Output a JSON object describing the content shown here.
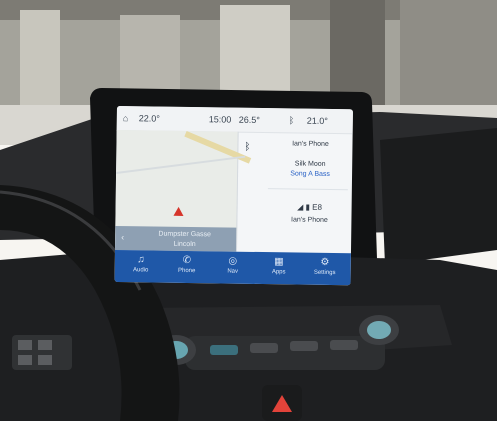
{
  "status_bar": {
    "temp_left": "22.0°",
    "clock": "15:00",
    "outside_temp": "26.5°",
    "temp_right": "21.0°"
  },
  "navigation": {
    "street_line1": "Dumpster Gasse",
    "street_line2": "Lincoln"
  },
  "phone_panel": {
    "device_name": "Ian's Phone",
    "call_status": "Silk Moon",
    "call_action": "Song A Bass",
    "signal_line": "◢ ▮ E8",
    "device_name_2": "Ian's Phone"
  },
  "dock": [
    {
      "icon": "audio-icon",
      "glyph": "♫",
      "label": "Audio"
    },
    {
      "icon": "phone-icon",
      "glyph": "✆",
      "label": "Phone"
    },
    {
      "icon": "navigation-icon",
      "glyph": "◎",
      "label": "Nav"
    },
    {
      "icon": "apps-icon",
      "glyph": "▦",
      "label": "Apps"
    },
    {
      "icon": "settings-icon",
      "glyph": "⚙",
      "label": "Settings"
    }
  ]
}
